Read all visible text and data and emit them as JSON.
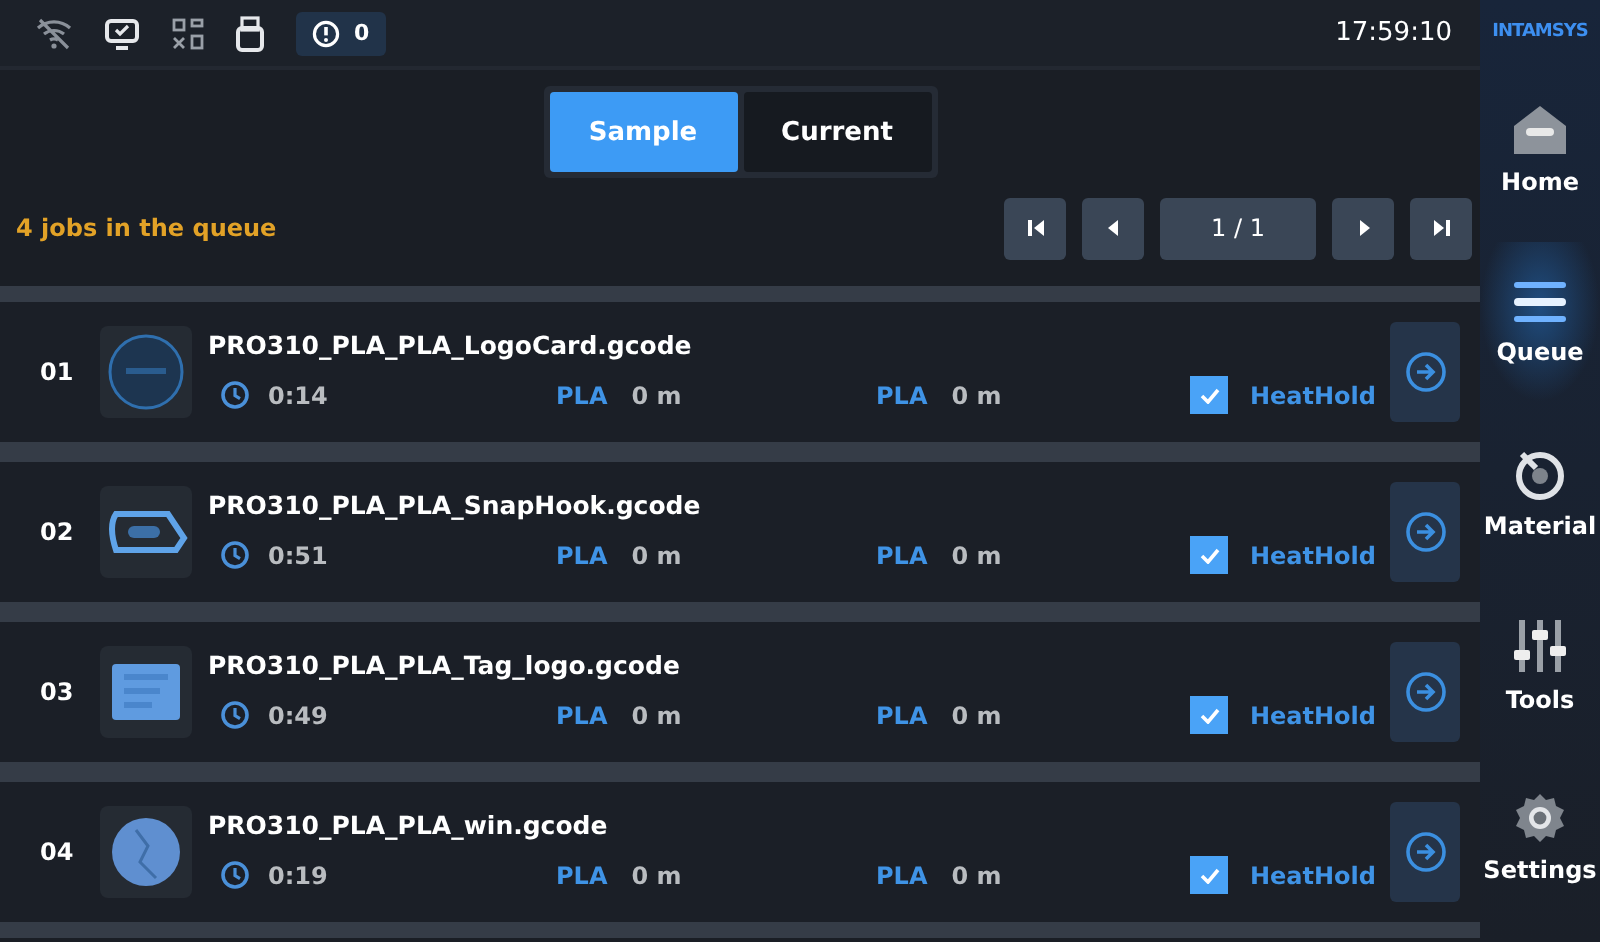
{
  "status_bar": {
    "alerts": "0",
    "time": "17:59:10"
  },
  "tabs": [
    {
      "label": "Sample",
      "selected": true
    },
    {
      "label": "Current",
      "selected": false
    }
  ],
  "queue_summary": "4 jobs in the queue",
  "pager": {
    "page": "1 / 1"
  },
  "jobs": [
    {
      "index": "01",
      "name": "PRO310_PLA_PLA_LogoCard.gcode",
      "time": "0:14",
      "material_1": "PLA",
      "length_1": "0 m",
      "material_2": "PLA",
      "length_2": "0 m",
      "heathold": {
        "label": "HeatHold",
        "checked": true
      }
    },
    {
      "index": "02",
      "name": "PRO310_PLA_PLA_SnapHook.gcode",
      "time": "0:51",
      "material_1": "PLA",
      "length_1": "0 m",
      "material_2": "PLA",
      "length_2": "0 m",
      "heathold": {
        "label": "HeatHold",
        "checked": true
      }
    },
    {
      "index": "03",
      "name": "PRO310_PLA_PLA_Tag_logo.gcode",
      "time": "0:49",
      "material_1": "PLA",
      "length_1": "0 m",
      "material_2": "PLA",
      "length_2": "0 m",
      "heathold": {
        "label": "HeatHold",
        "checked": true
      }
    },
    {
      "index": "04",
      "name": "PRO310_PLA_PLA_win.gcode",
      "time": "0:19",
      "material_1": "PLA",
      "length_1": "0 m",
      "material_2": "PLA",
      "length_2": "0 m",
      "heathold": {
        "label": "HeatHold",
        "checked": true
      }
    }
  ],
  "sidebar": {
    "brand": "INTAMSYS",
    "items": [
      {
        "kind": "home",
        "label": "Home",
        "selected": false
      },
      {
        "kind": "queue",
        "label": "Queue",
        "selected": true
      },
      {
        "kind": "material",
        "label": "Material",
        "selected": false
      },
      {
        "kind": "tools",
        "label": "Tools",
        "selected": false
      },
      {
        "kind": "settings",
        "label": "Settings",
        "selected": false
      }
    ]
  }
}
